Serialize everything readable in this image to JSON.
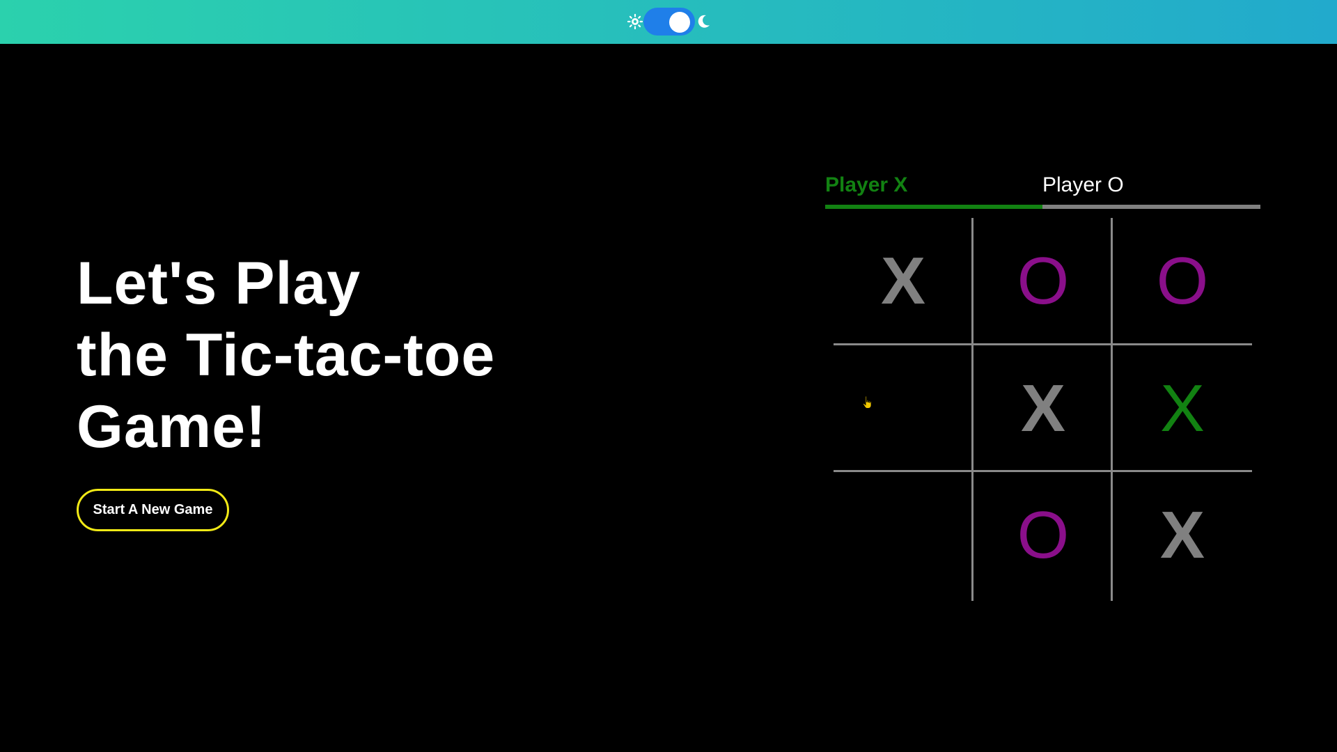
{
  "header": {
    "theme_toggle": {
      "left_icon": "sun-icon",
      "right_icon": "moon-icon",
      "state": "on",
      "track_color": "#1f7fe9",
      "gradient": [
        "#2bd1ad",
        "#22aacc"
      ]
    }
  },
  "hero": {
    "title_lines": [
      "Let's Play",
      "the Tic-tac-toe",
      "Game!"
    ],
    "new_game_label": "Start A New Game",
    "button_border_color": "#f2ea16"
  },
  "players": {
    "x_label": "Player X",
    "o_label": "Player O",
    "active": "Player X",
    "active_color": "#128212",
    "inactive_color": "#808080"
  },
  "board": {
    "cells": [
      [
        "X",
        "O",
        "O"
      ],
      [
        "",
        "X",
        "X"
      ],
      [
        "",
        "O",
        "X"
      ]
    ],
    "colors": {
      "x": "#808080",
      "o": "#8a0f8a",
      "highlight": "#128212"
    },
    "highlighted_cell": "row 2, column 3"
  },
  "cursor": {
    "icon": "pointer-hand-icon",
    "color": "#f2c800"
  }
}
